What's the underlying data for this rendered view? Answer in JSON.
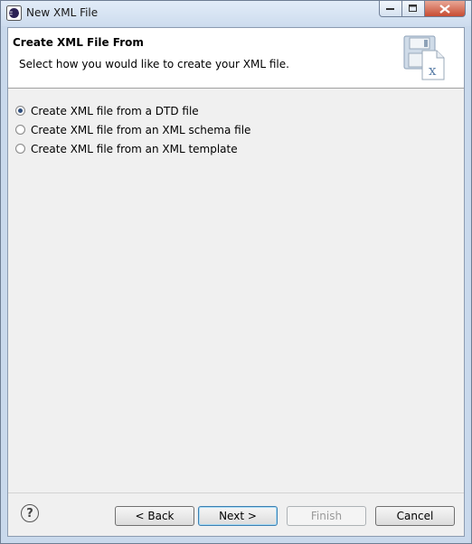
{
  "window": {
    "title": "New XML File",
    "icon": "eclipse-icon",
    "controls": {
      "minimize": "minimize-icon",
      "maximize": "maximize-icon",
      "close": "close-icon"
    }
  },
  "header": {
    "title": "Create XML File From",
    "description": "Select how you would like to create your XML file.",
    "icon": "xml-file-wizard-icon"
  },
  "options": [
    {
      "label": "Create XML file from a DTD file",
      "checked": true
    },
    {
      "label": "Create XML file from an XML schema file",
      "checked": false
    },
    {
      "label": "Create XML file from an XML template",
      "checked": false
    }
  ],
  "footer": {
    "help_icon": "help-icon",
    "help_symbol": "?",
    "back_label": "< Back",
    "next_label": "Next >",
    "finish_label": "Finish",
    "cancel_label": "Cancel",
    "finish_enabled": false
  }
}
